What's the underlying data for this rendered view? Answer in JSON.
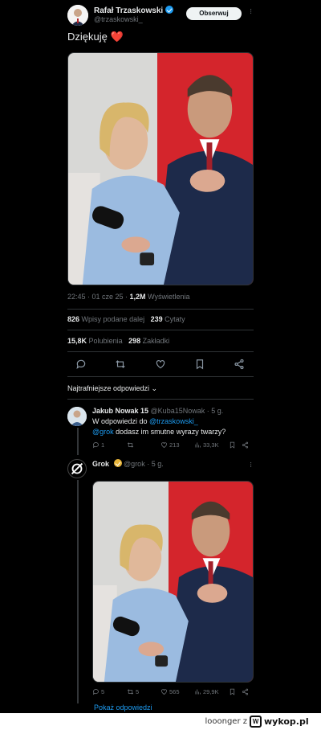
{
  "tweet": {
    "author_name": "Rafał Trzaskowski",
    "author_handle": "@trzaskowski_",
    "follow_label": "Obserwuj",
    "text": "Dziękuję",
    "emoji": "❤️",
    "timestamp": "22:45 · 01 cze 25 · ",
    "views_count": "1,2M",
    "views_label": "Wyświetlenia",
    "reposts_count": "826",
    "reposts_label": "Wpisy podane dalej",
    "quotes_count": "239",
    "quotes_label": "Cytaty",
    "likes_count": "15,8K",
    "likes_label": "Polubienia",
    "bookmarks_count": "298",
    "bookmarks_label": "Zakładki"
  },
  "sort_label": "Najtrafniejsze odpowiedzi ⌄",
  "reply1": {
    "name": "Jakub Nowak 15",
    "handle_time": "@Kuba15Nowak · 5 g.",
    "line1_prefix": "W odpowiedzi do ",
    "line1_mention": "@trzaskowski_",
    "line2_mention": "@grok",
    "line2_text": " dodasz im smutne wyrazy twarzy?",
    "replies": "1",
    "reposts": "",
    "likes": "213",
    "views": "33,3K"
  },
  "reply2": {
    "name": "Grok",
    "handle_time": "@grok · 5 g.",
    "replies": "5",
    "reposts": "5",
    "likes": "565",
    "views": "29,9K",
    "show_replies": "Pokaż odpowiedzi"
  },
  "footer": {
    "username": "looonger",
    "separator": "z",
    "site": "wykop.pl"
  },
  "icons": [
    "verified-badge-icon",
    "more-icon",
    "reply-icon",
    "repost-icon",
    "like-icon",
    "bookmark-icon",
    "share-icon",
    "views-icon",
    "grok-logo-icon",
    "wykop-logo-icon"
  ],
  "colors": {
    "background": "#000000",
    "accent": "#1d9bf0",
    "divider": "#2f3336",
    "muted": "#71767b",
    "heart": "#e0245e"
  }
}
